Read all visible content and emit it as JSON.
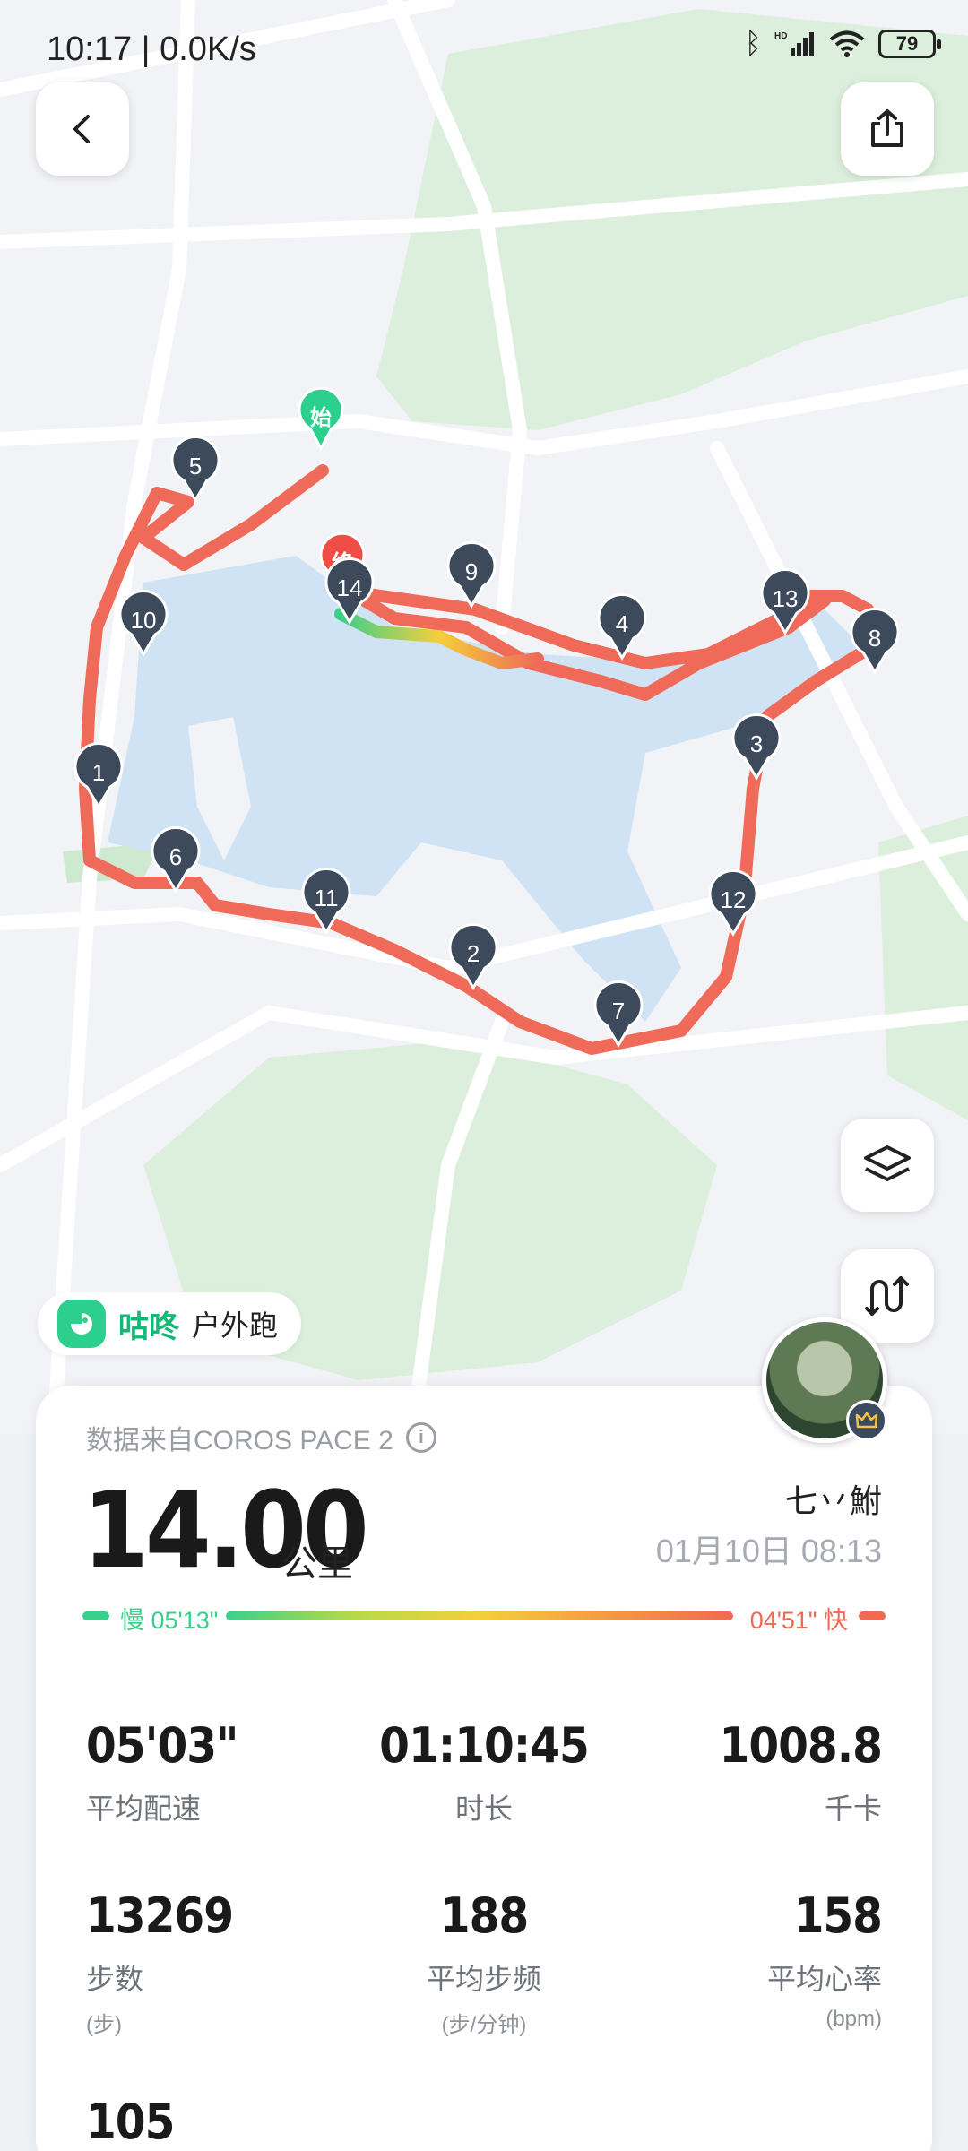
{
  "status_bar": {
    "time": "10:17 | 0.0K/s",
    "battery": "79"
  },
  "map": {
    "start_label": "始",
    "end_label": "终",
    "km_markers": [
      "1",
      "2",
      "3",
      "4",
      "5",
      "6",
      "7",
      "8",
      "9",
      "10",
      "11",
      "12",
      "13",
      "14"
    ],
    "route_color": "#ef6a58"
  },
  "app": {
    "name": "咕咚",
    "activity_type": "户外跑"
  },
  "card": {
    "source": "数据来自COROS PACE 2",
    "distance": "14.00",
    "distance_unit": "公里",
    "username": "七丷鮒",
    "datetime": "01月10日 08:13",
    "pace_scale": {
      "slow": "慢 05'13\"",
      "fast": "04'51\" 快",
      "slow_color": "#3ccf8a",
      "fast_color": "#ef6a52"
    }
  },
  "stats": [
    {
      "value": "05'03\"",
      "label": "平均配速"
    },
    {
      "value": "01:10:45",
      "label": "时长"
    },
    {
      "value": "1008.8",
      "label": "千卡"
    },
    {
      "value": "13269",
      "label": "步数",
      "unit": "(步)"
    },
    {
      "value": "188",
      "label": "平均步频",
      "unit": "(步/分钟)"
    },
    {
      "value": "158",
      "label": "平均心率",
      "unit": "(bpm)"
    },
    {
      "value": "105"
    }
  ]
}
